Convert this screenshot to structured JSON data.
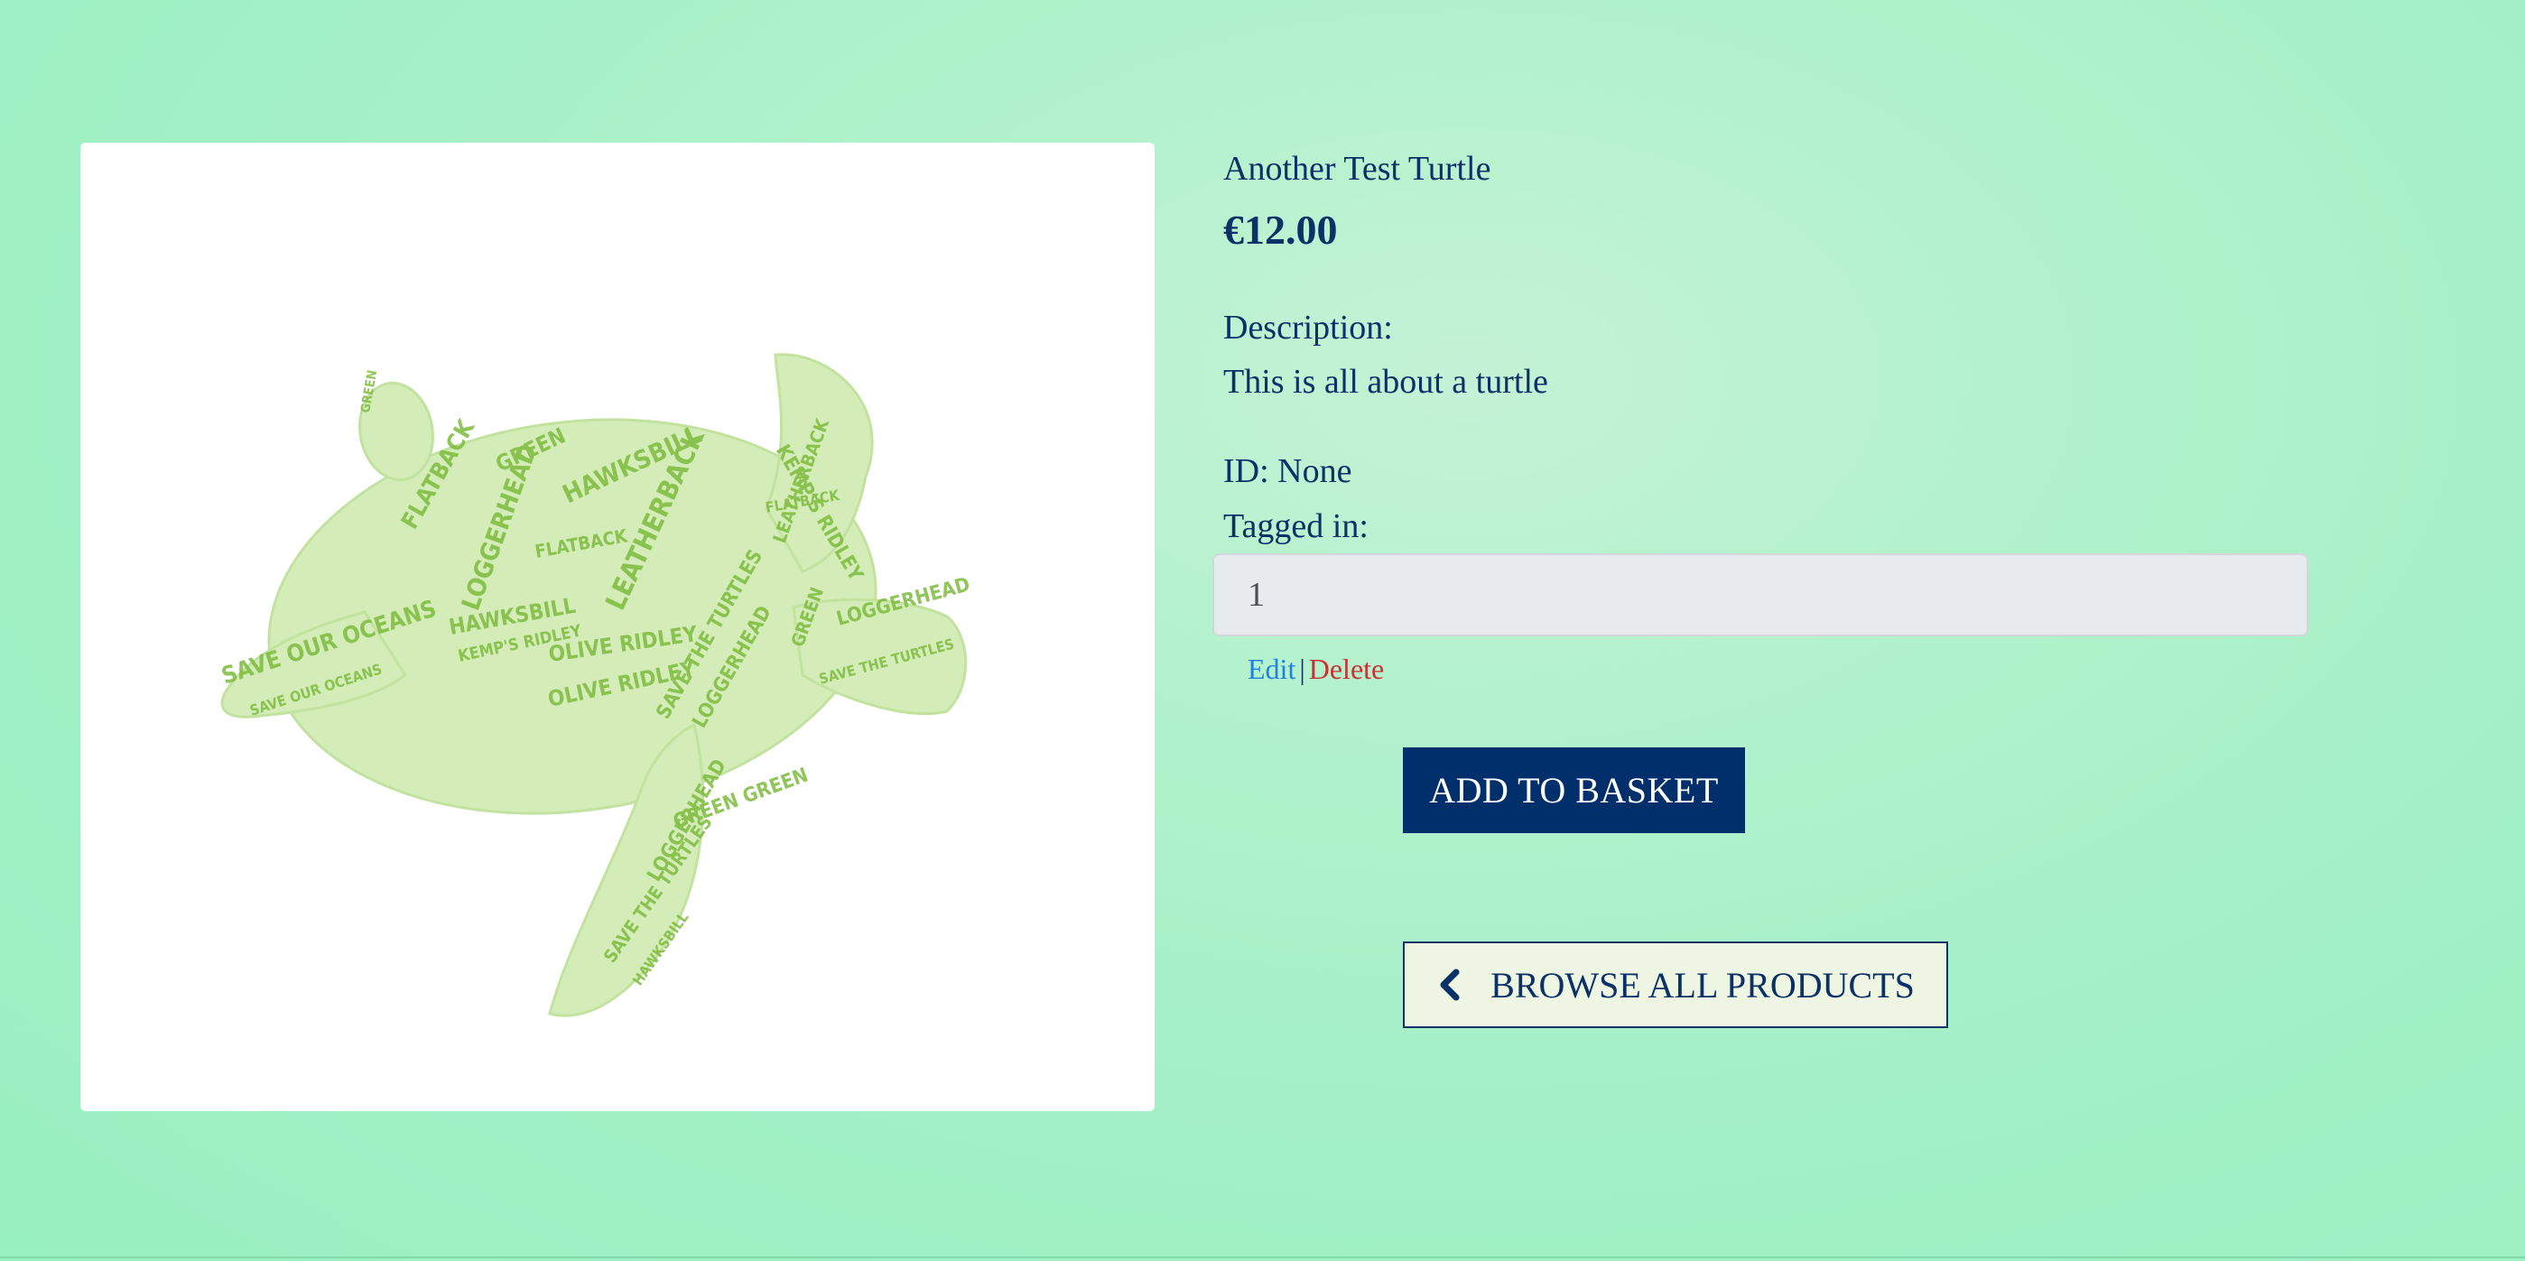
{
  "product": {
    "name": "Another Test Turtle",
    "price": "€12.00",
    "description_label": "Description:",
    "description": "This is all about a turtle",
    "id_text": "ID: None",
    "tagged_label": "Tagged in:",
    "tag_value": "1"
  },
  "admin": {
    "edit_label": "Edit",
    "separator": "|",
    "delete_label": "Delete"
  },
  "actions": {
    "add_to_basket_label": "ADD TO BASKET",
    "browse_label": "BROWSE ALL PRODUCTS",
    "browse_icon": "chevron-left-icon"
  },
  "image": {
    "subject": "turtle word cloud",
    "words": [
      "SAVE OUR OCEANS",
      "FLATBACK",
      "OLIVE RIDLEY",
      "GREEN",
      "HAWKSBILL",
      "LOGGERHEAD",
      "LEATHERBACK",
      "KEMP'S RIDLEY",
      "SAVE THE TURTLES"
    ]
  },
  "colors": {
    "background": "#a8f0c8",
    "text": "#0b3166",
    "primary_button": "#002f6c",
    "edit_link": "#1f80e8",
    "delete_link": "#cc3030",
    "turtle_green": "#8cc63f"
  }
}
